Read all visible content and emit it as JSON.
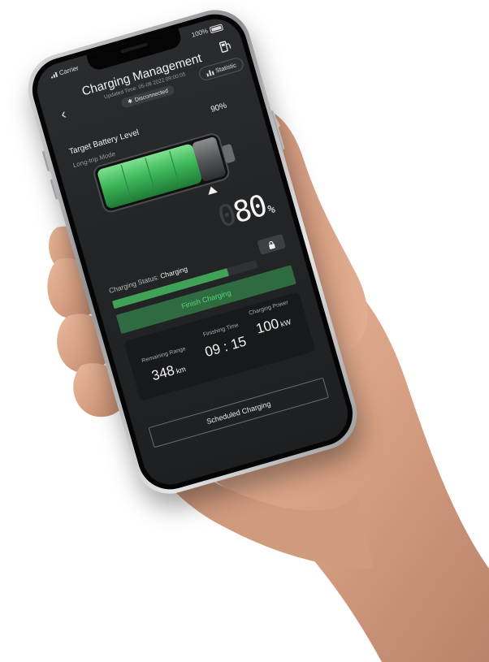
{
  "status_bar": {
    "carrier": "Carrier",
    "battery_percent": "100%"
  },
  "header": {
    "title": "Charging Management",
    "updated": "Updated Time: 05-09 2022  09:00:05",
    "connection_status": "Disconnected",
    "statistic_label": "Statistic"
  },
  "target": {
    "label": "Target Battery Level",
    "percent": "90%",
    "mode": "Long-trip Mode",
    "level": 0.9,
    "current_level": 0.8
  },
  "current": {
    "ghost_digit": "0",
    "value": "80",
    "unit": "%"
  },
  "charging": {
    "status_label": "Charging Status:",
    "status_value": "Charging",
    "progress": 0.8,
    "finish_label": "Finish Charging"
  },
  "stats": {
    "range_label": "Remaining Range",
    "range_value": "348",
    "range_unit": "km",
    "time_label": "Finishing Time",
    "time_value": "09 : 15",
    "power_label": "Charging Power",
    "power_value": "100",
    "power_unit": "kW"
  },
  "scheduled_label": "Scheduled Charging",
  "colors": {
    "accent_green": "#3fa256",
    "finish_text": "#59d27a",
    "screen_bg": "#232527"
  },
  "icons": {
    "back": "chevron-left-icon",
    "fuel": "fuel-pump-icon",
    "bluetooth": "bluetooth-icon",
    "statistic": "bar-chart-icon",
    "lock": "lock-icon"
  }
}
